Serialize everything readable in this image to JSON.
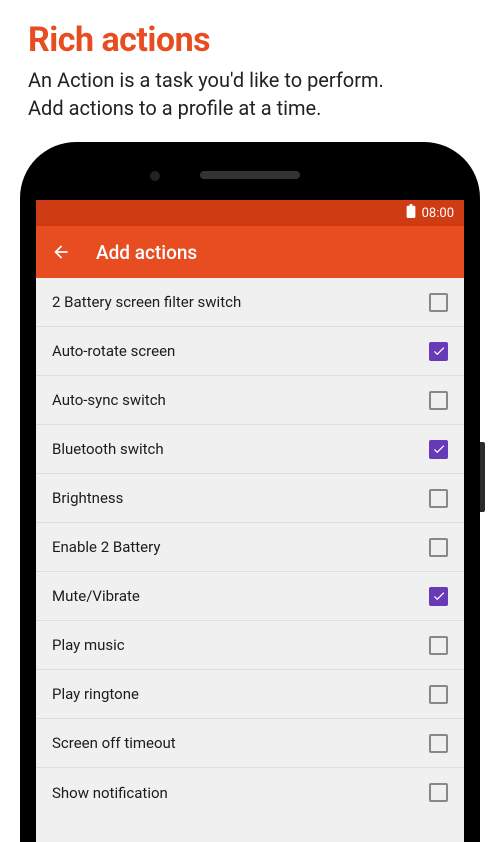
{
  "header": {
    "title": "Rich actions",
    "subtitle_line1": "An Action is a task you'd like to perform.",
    "subtitle_line2": "Add actions to a profile at a time."
  },
  "status_bar": {
    "time": "08:00"
  },
  "app_bar": {
    "title": "Add actions"
  },
  "items": [
    {
      "label": "2 Battery screen filter switch",
      "checked": false
    },
    {
      "label": "Auto-rotate screen",
      "checked": true
    },
    {
      "label": "Auto-sync switch",
      "checked": false
    },
    {
      "label": "Bluetooth switch",
      "checked": true
    },
    {
      "label": "Brightness",
      "checked": false
    },
    {
      "label": "Enable 2 Battery",
      "checked": false
    },
    {
      "label": "Mute/Vibrate",
      "checked": true
    },
    {
      "label": "Play music",
      "checked": false
    },
    {
      "label": "Play ringtone",
      "checked": false
    },
    {
      "label": "Screen off timeout",
      "checked": false
    },
    {
      "label": "Show notification",
      "checked": false
    }
  ]
}
